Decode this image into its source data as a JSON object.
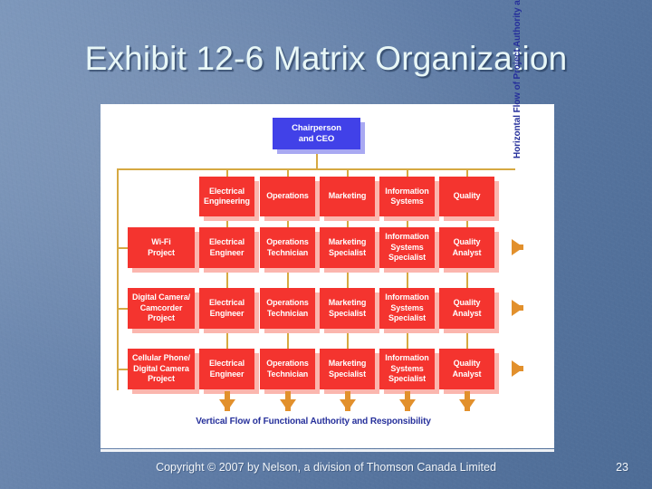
{
  "slide": {
    "title": "Exhibit 12-6 Matrix Organization",
    "page_number": "23",
    "copyright": "Copyright © 2007 by Nelson, a division of Thomson Canada Limited"
  },
  "diagram": {
    "top_box": "Chairperson\nand CEO",
    "functional_headers": [
      "Electrical\nEngineering",
      "Operations",
      "Marketing",
      "Information\nSystems",
      "Quality"
    ],
    "projects": [
      {
        "name": "Wi-Fi\nProject",
        "roles": [
          "Electrical\nEngineer",
          "Operations\nTechnician",
          "Marketing\nSpecialist",
          "Information\nSystems\nSpecialist",
          "Quality\nAnalyst"
        ]
      },
      {
        "name": "Digital Camera/\nCamcorder\nProject",
        "roles": [
          "Electrical\nEngineer",
          "Operations\nTechnician",
          "Marketing\nSpecialist",
          "Information\nSystems\nSpecialist",
          "Quality\nAnalyst"
        ]
      },
      {
        "name": "Cellular Phone/\nDigital Camera\nProject",
        "roles": [
          "Electrical\nEngineer",
          "Operations\nTechnician",
          "Marketing\nSpecialist",
          "Information\nSystems\nSpecialist",
          "Quality\nAnalyst"
        ]
      }
    ],
    "caption_bottom": "Vertical Flow of Functional Authority and Responsibility",
    "caption_right": "Horizontal Flow of Project Authority and Responsibility",
    "colors": {
      "executive_box": "#4141e8",
      "unit_box": "#f4342f",
      "connector": "#d6a942",
      "arrow": "#e2902c",
      "caption_text": "#26309b",
      "panel_background": "#ffffff"
    }
  }
}
